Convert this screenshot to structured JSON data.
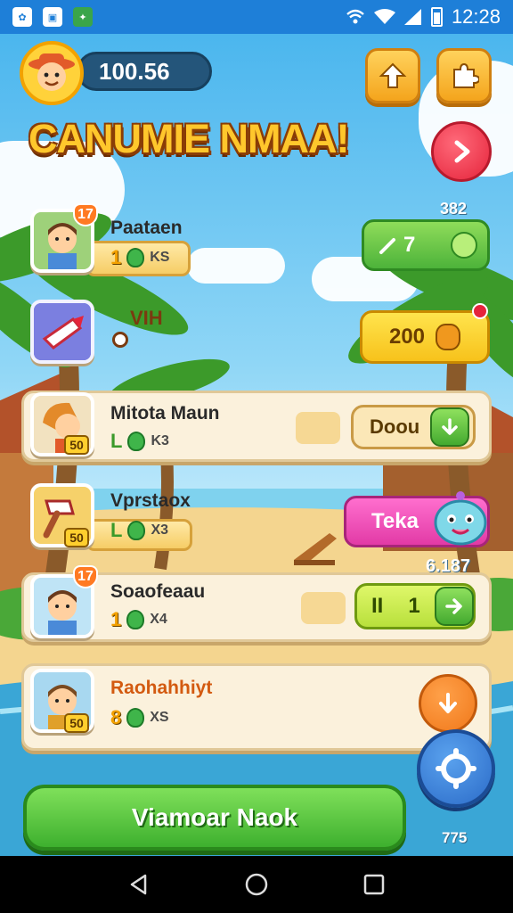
{
  "status_bar": {
    "time": "12:28",
    "app_icons": [
      "photos-app-icon",
      "gallery-app-icon",
      "game-app-icon"
    ]
  },
  "hud": {
    "coins": "100.56",
    "profile_icon": "farmer-avatar-icon",
    "upgrade_icon": "arrow-up-icon",
    "settings_icon": "puzzle-icon"
  },
  "title": "CANUMIE NMAA!",
  "next_button_icon": "chevron-right-icon",
  "side_labels": {
    "top_right_value": "382",
    "decor_text": "VIH",
    "right_mid_value": "6.187",
    "bottom_right_value": "775"
  },
  "rows": [
    {
      "name": "Paataen",
      "level": "1",
      "multiplier": "KS",
      "heart": "17",
      "badge": ""
    },
    {
      "name": "",
      "level": "",
      "multiplier": "",
      "heart": "",
      "badge": ""
    },
    {
      "name": "Mitota Maun",
      "level": "L",
      "multiplier": "K3",
      "heart": "",
      "badge": "50"
    },
    {
      "name": "Vprstaox",
      "level": "L",
      "multiplier": "X3",
      "heart": "",
      "badge": "50"
    },
    {
      "name": "Soaofeaau",
      "level": "1",
      "multiplier": "X4",
      "heart": "17",
      "badge": ""
    },
    {
      "name": "Raohahhiyt",
      "level": "8",
      "multiplier": "XS",
      "heart": "",
      "badge": "50"
    }
  ],
  "actions": {
    "row1": {
      "label": "7"
    },
    "row2": {
      "label": "200"
    },
    "row3": {
      "label": "Doou"
    },
    "row4": {
      "label": "Teka"
    },
    "row5": {
      "left": "II",
      "right": "1"
    }
  },
  "play_button": "Viamoar Naok",
  "colors": {
    "primary_green": "#4db33a",
    "title_gold": "#ffc72c",
    "status_blue": "#1e7fd8",
    "accent_orange": "#f0781a"
  }
}
